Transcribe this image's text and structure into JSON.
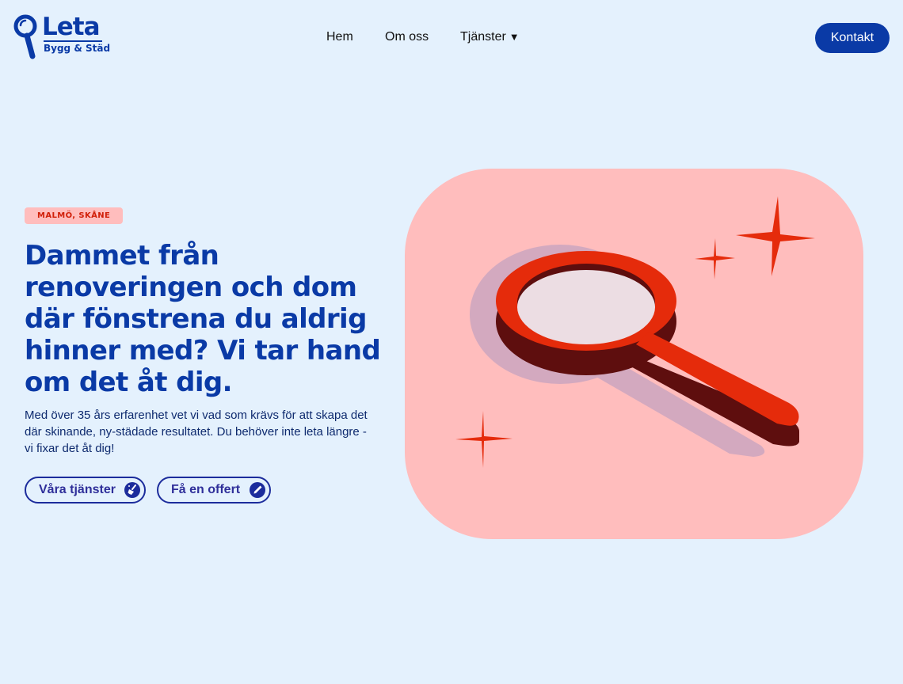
{
  "header": {
    "logo": {
      "word": "Leta",
      "sub": "Bygg & Städ",
      "icon": "magnifier-logo-icon"
    },
    "nav": {
      "items": [
        {
          "label": "Hem"
        },
        {
          "label": "Om oss"
        },
        {
          "label": "Tjänster",
          "caret": "▼"
        }
      ]
    },
    "contact_label": "Kontakt"
  },
  "hero": {
    "badge": "MALMÖ, SKÅNE",
    "headline": "Dammet från renoveringen och dom där fönstrena du aldrig hinner med? Vi tar hand om det åt dig.",
    "lead": "Med över 35 års erfarenhet vet vi vad som krävs för att skapa det där skinande, ny-städade resultatet. Du behöver inte leta längre - vi fixar det åt dig!",
    "buttons": [
      {
        "label": "Våra tjänster",
        "icon": "broom-icon"
      },
      {
        "label": "Få en offert",
        "icon": "pencil-icon"
      }
    ],
    "illustration": {
      "icon": "magnifying-glass-illustration"
    }
  },
  "colors": {
    "background": "#e4f1fd",
    "brand_blue": "#0a3aa6",
    "badge_bg": "#ffbdbd",
    "badge_text": "#d1200a",
    "art_bg": "#ffbdbd",
    "magnifier_red": "#e52b0b",
    "magnifier_shadow": "#5e0e0e"
  }
}
